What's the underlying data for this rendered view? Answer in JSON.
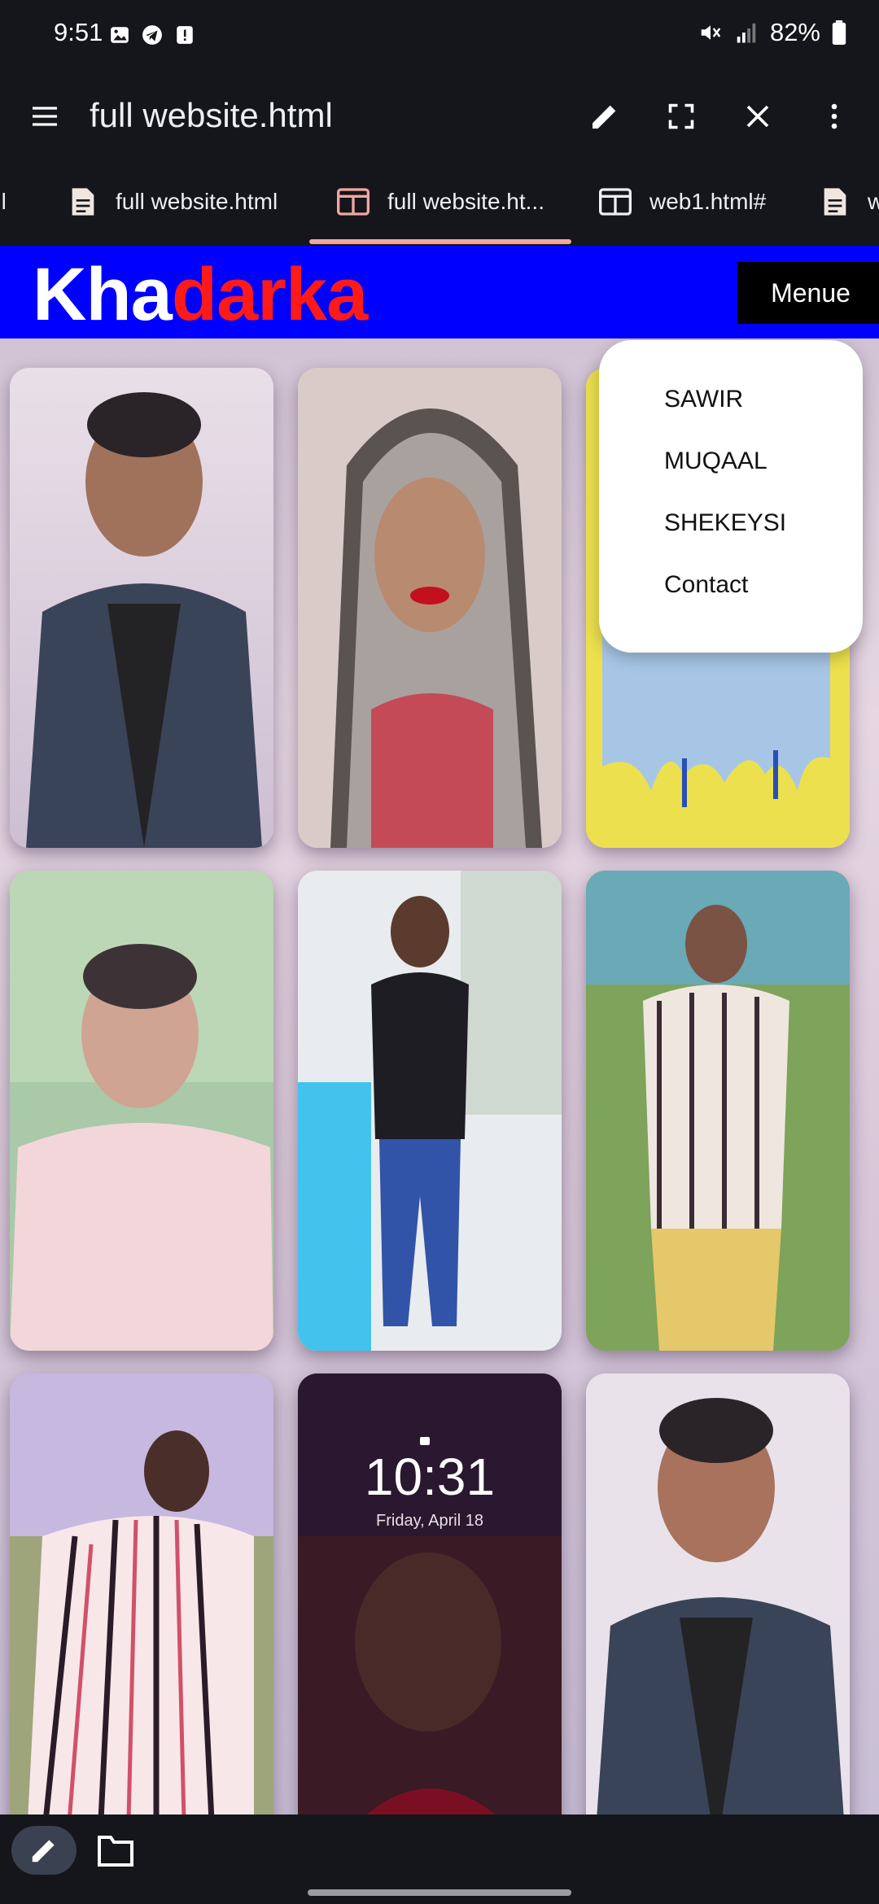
{
  "status": {
    "time": "9:51",
    "battery": "82%"
  },
  "appbar": {
    "title": "full website.html"
  },
  "tabs": [
    {
      "label": "nl"
    },
    {
      "label": "full website.html"
    },
    {
      "label": "full website.ht..."
    },
    {
      "label": "web1.html#"
    },
    {
      "label": "w"
    }
  ],
  "site": {
    "logo_white": "Kha",
    "logo_red": "darka",
    "menu_button": "Menue",
    "menu_items": [
      "SAWIR",
      "MUQAAL",
      "SHEKEYSI",
      "Contact"
    ],
    "lock_time": "10:31",
    "lock_date": "Friday, April 18"
  },
  "colors": {
    "header_blue": "#0000ff",
    "logo_red": "#ff1a1a",
    "tab_indicator": "#f2a6a0",
    "chrome_bg": "#14161b"
  }
}
